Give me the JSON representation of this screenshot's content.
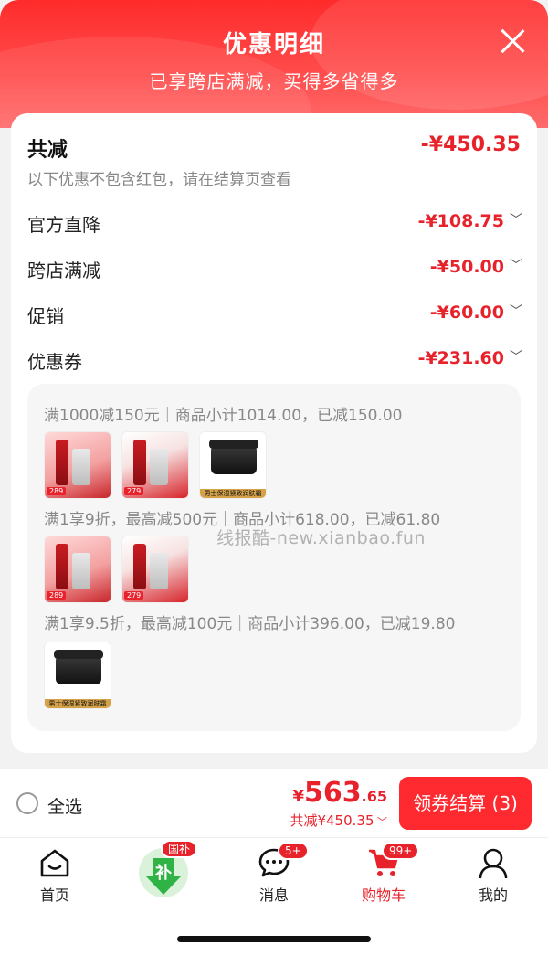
{
  "header": {
    "title": "优惠明细",
    "subtitle": "已享跨店满减，买得多省得多"
  },
  "summary": {
    "total_label": "共减",
    "total_value": "-¥450.35",
    "note": "以下优惠不包含红包，请在结算页查看"
  },
  "discounts": [
    {
      "label": "官方直降",
      "value": "-¥108.75"
    },
    {
      "label": "跨店满减",
      "value": "-¥50.00"
    },
    {
      "label": "促销",
      "value": "-¥60.00"
    },
    {
      "label": "优惠券",
      "value": "-¥231.60"
    }
  ],
  "rules": [
    {
      "text": "满1000减150元｜商品小计1014.00，已减150.00"
    },
    {
      "text": "满1享9折，最高减500元｜商品小计618.00，已减61.80"
    },
    {
      "text": "满1享9.5折，最高减100元｜商品小计396.00，已减19.80"
    }
  ],
  "thumb_labels": {
    "price_289": "289",
    "price_279": "279",
    "jar_strip": "男士保湿紧致润肤霜50g"
  },
  "watermark": "线报酷-new.xianbao.fun",
  "checkout": {
    "select_all": "全选",
    "currency": "¥",
    "price_int": "563",
    "price_dec": ".65",
    "discount_text": "共减¥450.35",
    "button": "领券结算 (3)"
  },
  "tabs": [
    {
      "label": "首页",
      "icon": "home-icon"
    },
    {
      "label": "",
      "icon": "subsidy-icon",
      "badge": "国补",
      "glyph": "补"
    },
    {
      "label": "消息",
      "icon": "message-icon",
      "badge": "5+"
    },
    {
      "label": "购物车",
      "icon": "cart-icon",
      "badge": "99+"
    },
    {
      "label": "我的",
      "icon": "profile-icon"
    }
  ],
  "colors": {
    "accent": "#e8222b",
    "header": "#ff2b2b",
    "button": "#ff2a2f"
  }
}
